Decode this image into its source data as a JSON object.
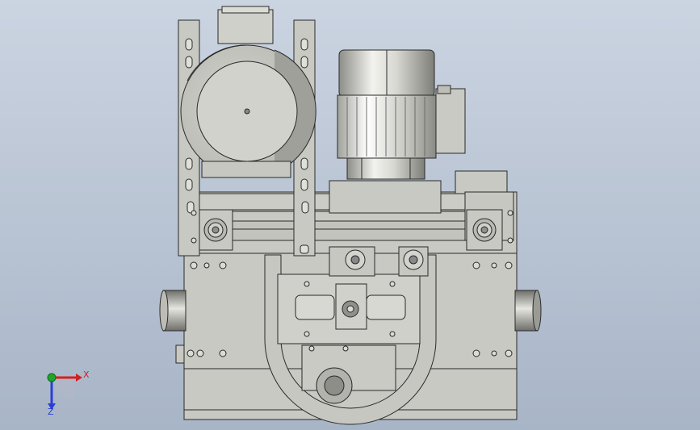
{
  "colors": {
    "bg_top": "#c8d2e0",
    "bg_bottom": "#a9b6c8",
    "body_fill": "#c8c9c2",
    "body_dark": "#b4b5ae",
    "edge": "#2a2a2a",
    "axis_x": "#d42020",
    "axis_y": "#1fa52a",
    "axis_z": "#2a3fd6"
  },
  "triad": {
    "x_label": "X",
    "z_label": "Z"
  }
}
